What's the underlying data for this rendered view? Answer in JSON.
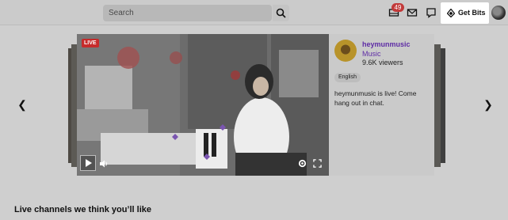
{
  "search": {
    "placeholder": "Search"
  },
  "header": {
    "notifications_badge": "49",
    "get_bits_label": "Get Bits",
    "icons": [
      "search-icon",
      "notifications-icon",
      "inbox-icon",
      "whispers-icon",
      "bits-icon",
      "user-avatar"
    ]
  },
  "featured": {
    "live_label": "LIVE",
    "channel_name": "heymunmusic",
    "category": "Music",
    "viewers": "9.6K viewers",
    "tags": [
      "English"
    ],
    "description": "heymunmusic is live! Come hang out in chat."
  },
  "sections": {
    "live_channels_title": "Live channels we think you’ll like"
  },
  "colors": {
    "accent": "#5e2ca5",
    "live": "#c62b2b",
    "badge": "#c23a3a"
  }
}
